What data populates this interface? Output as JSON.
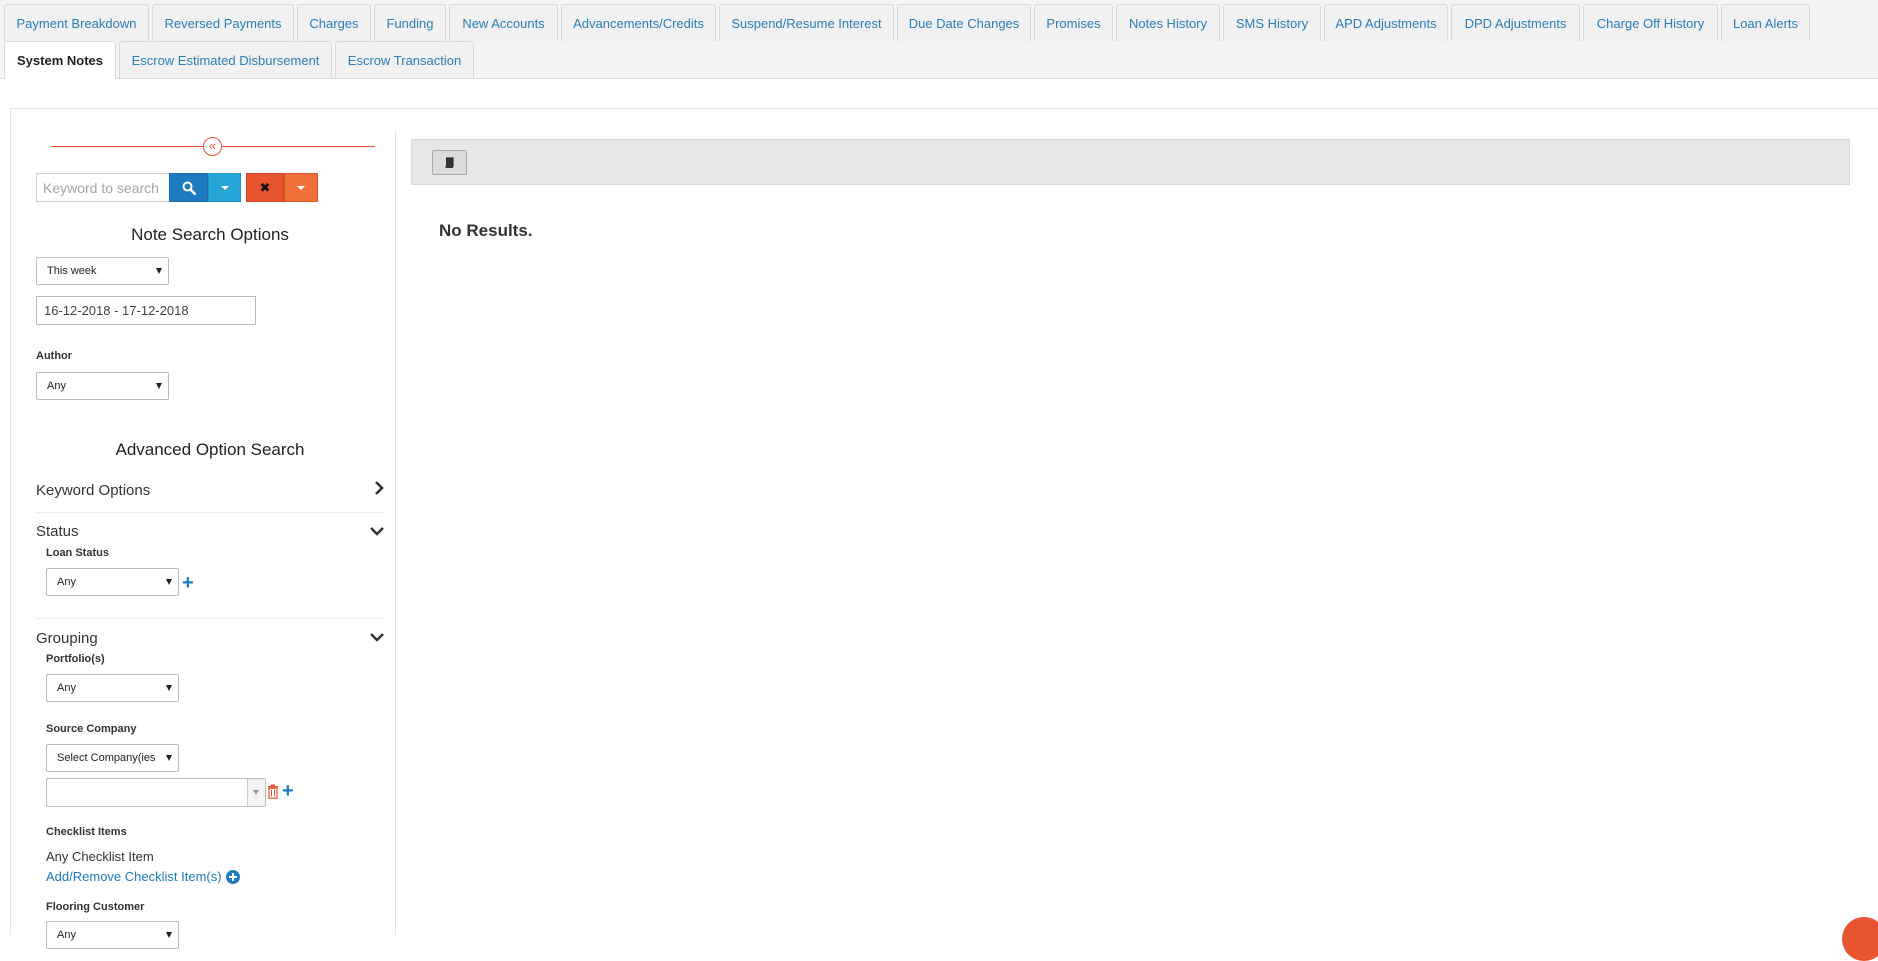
{
  "tabs": [
    {
      "label": "Payment Breakdown"
    },
    {
      "label": "Reversed Payments"
    },
    {
      "label": "Charges"
    },
    {
      "label": "Funding"
    },
    {
      "label": "New Accounts"
    },
    {
      "label": "Advancements/Credits"
    },
    {
      "label": "Suspend/Resume Interest"
    },
    {
      "label": "Due Date Changes"
    },
    {
      "label": "Promises"
    },
    {
      "label": "Notes History"
    },
    {
      "label": "SMS History"
    },
    {
      "label": "APD Adjustments"
    },
    {
      "label": "DPD Adjustments"
    },
    {
      "label": "Charge Off History"
    },
    {
      "label": "Loan Alerts"
    },
    {
      "label": "System Notes"
    },
    {
      "label": "Escrow Estimated Disbursement"
    },
    {
      "label": "Escrow Transaction"
    }
  ],
  "active_tab": "System Notes",
  "sidebar": {
    "collapse_icon": "double-chevron-left-icon",
    "search": {
      "placeholder": "Keyword to search"
    },
    "note_search_title": "Note Search Options",
    "date_range_select": "This week",
    "date_range_value": "16-12-2018 - 17-12-2018",
    "author_label": "Author",
    "author_select": "Any",
    "advanced_title": "Advanced Option Search",
    "keyword_options": "Keyword Options",
    "status": {
      "title": "Status",
      "loan_status_label": "Loan Status",
      "loan_status_select": "Any"
    },
    "grouping": {
      "title": "Grouping",
      "portfolios_label": "Portfolio(s)",
      "portfolios_select": "Any",
      "source_company_label": "Source Company",
      "source_company_select": "Select Company(ies",
      "checklist_label": "Checklist Items",
      "checklist_value": "Any Checklist Item",
      "checklist_link": "Add/Remove Checklist Item(s)",
      "flooring_label": "Flooring Customer",
      "flooring_select": "Any"
    }
  },
  "main": {
    "toolbar_icon": "book-icon",
    "no_results": "No Results."
  },
  "colors": {
    "primary": "#1f7bbf",
    "accent": "#e8542f",
    "info": "#27a5d6",
    "link": "#2a7fb8"
  }
}
